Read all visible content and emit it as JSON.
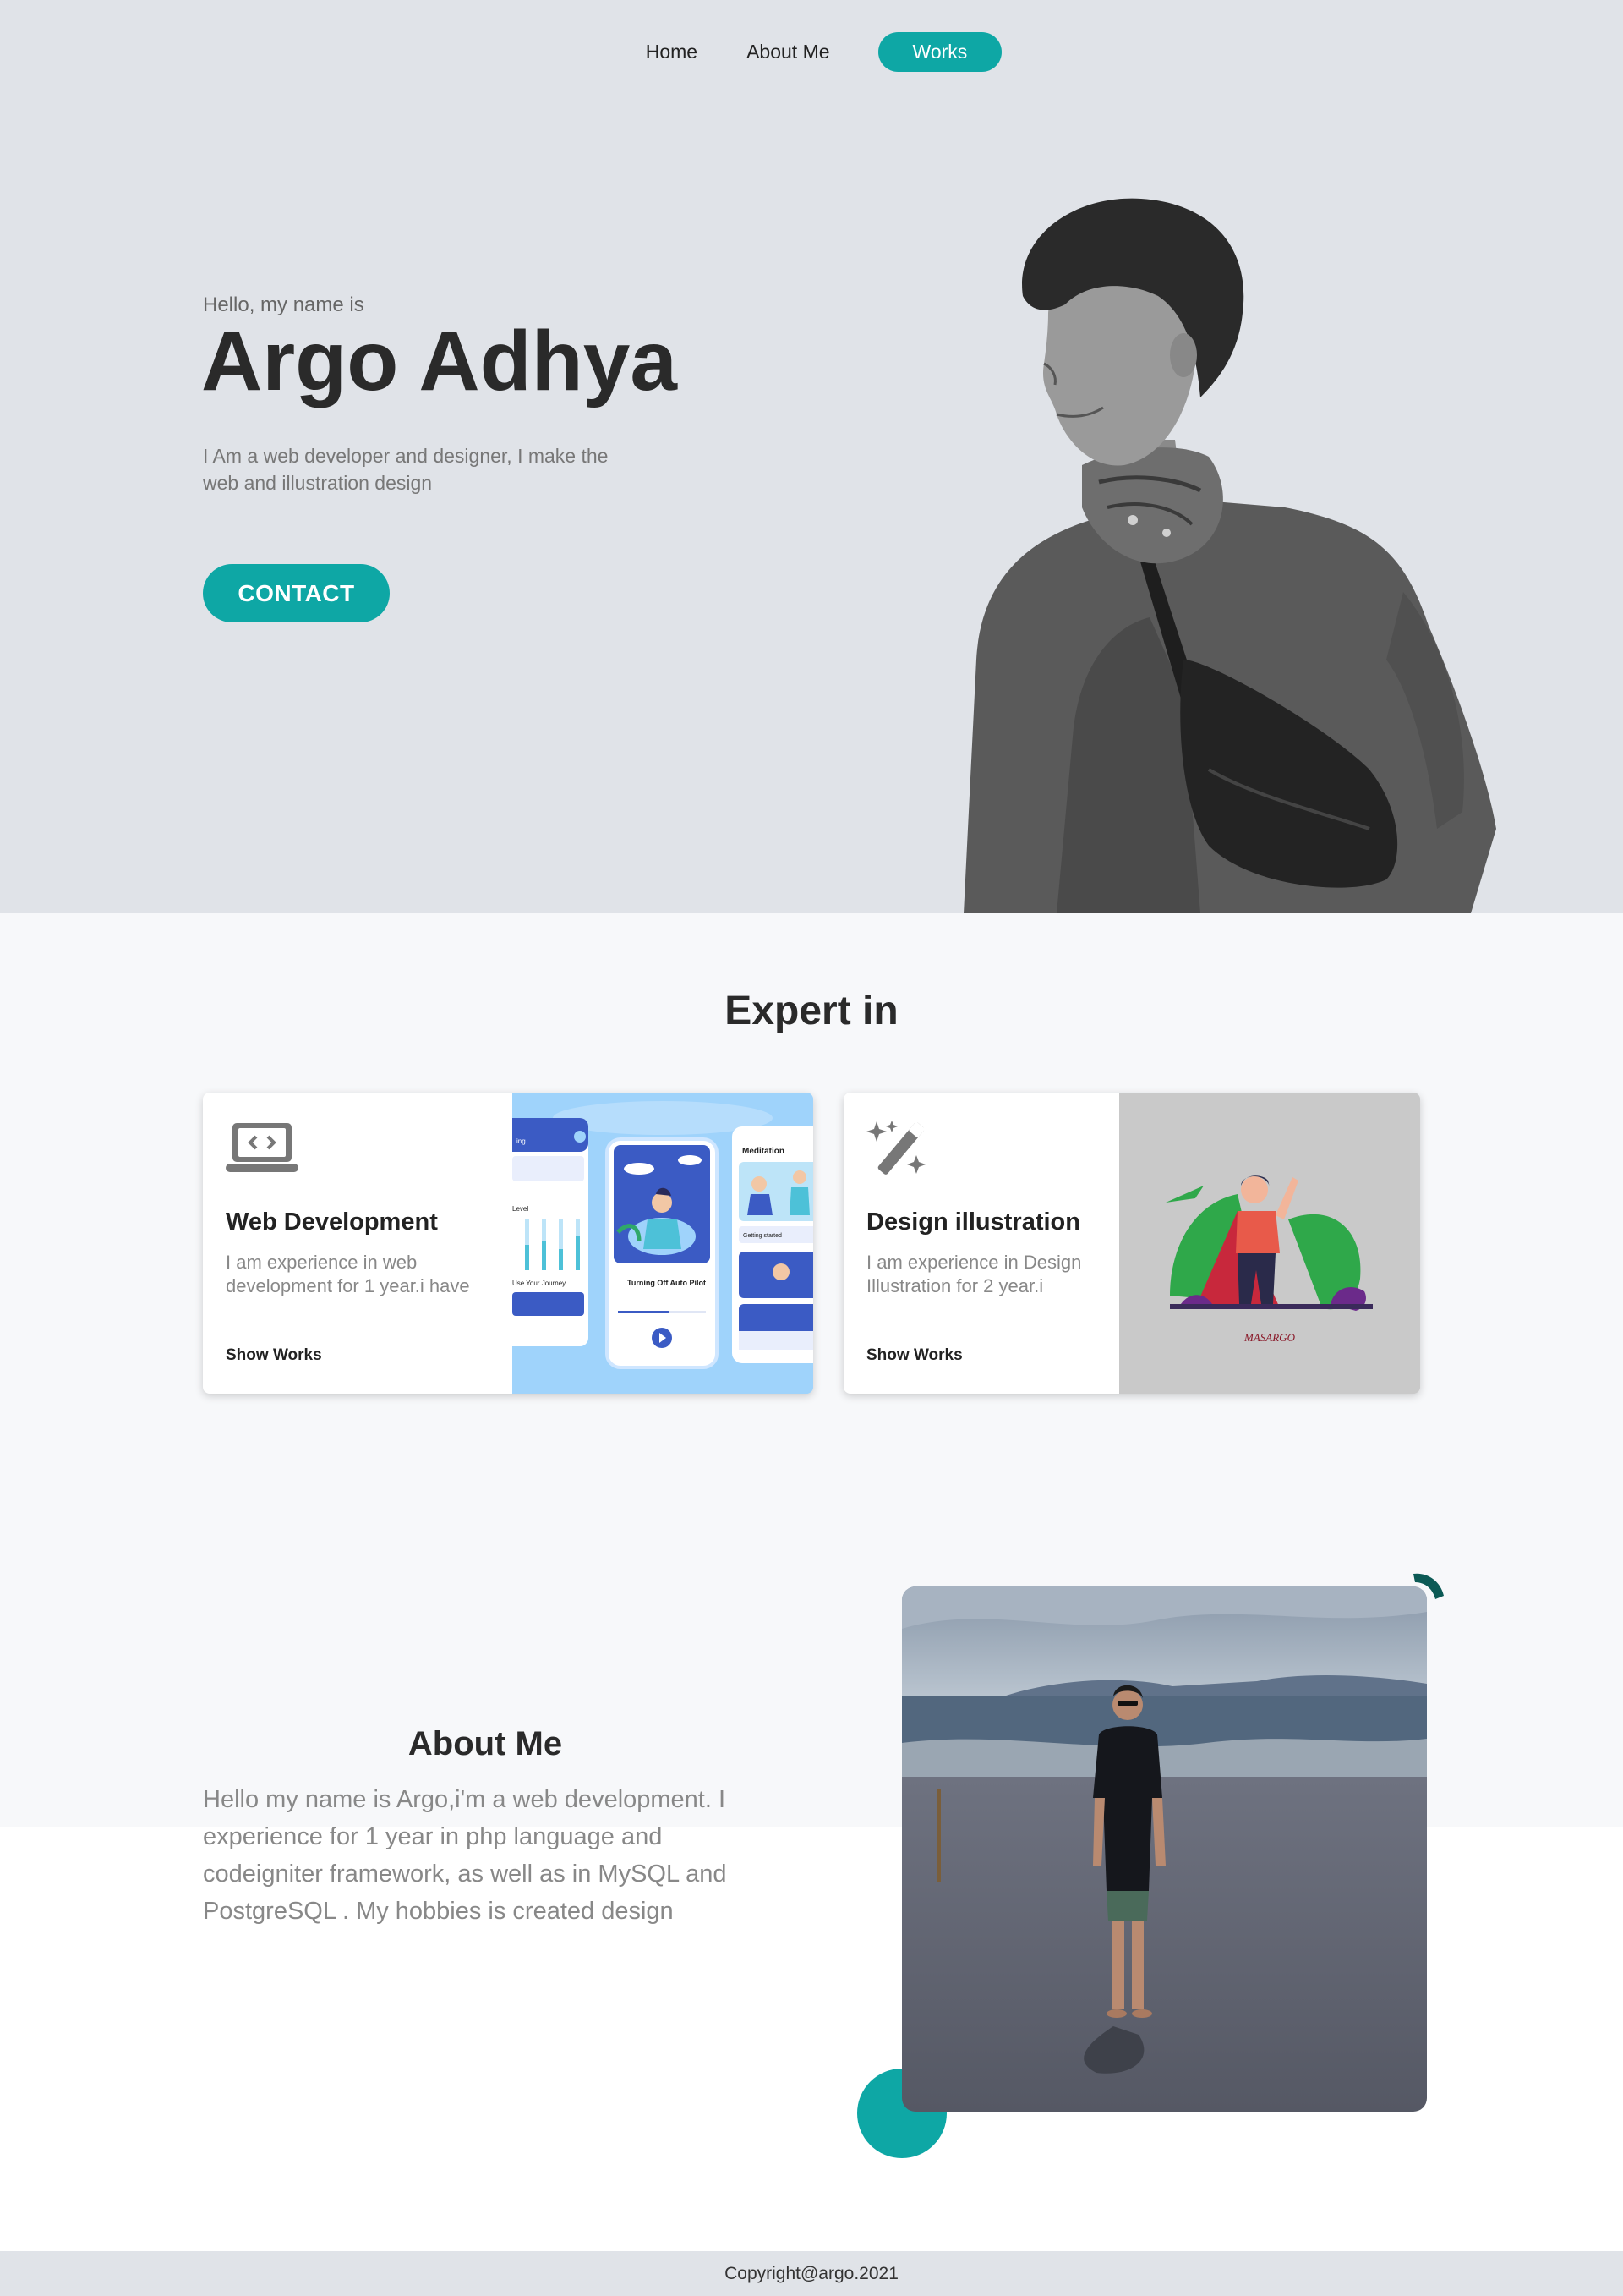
{
  "nav": {
    "items": [
      {
        "label": "Home"
      },
      {
        "label": "About Me"
      },
      {
        "label": "Works"
      }
    ],
    "active": "Works"
  },
  "hero": {
    "greeting": "Hello, my name is",
    "name": "Argo Adhya",
    "description": "I Am a web developer and designer, I make the web and illustration design",
    "contact_label": "CONTACT"
  },
  "expert": {
    "title": "Expert in",
    "cards": [
      {
        "icon": "laptop-code-icon",
        "title": "Web Development",
        "description": "I am experience in web development for 1 year.i have",
        "link": "Show Works",
        "preview_texts": [
          "Meditation",
          "Turning Off Auto Pilot",
          "Getting started",
          "Level",
          "Use Your Journey",
          "ing"
        ]
      },
      {
        "icon": "magic-wand-icon",
        "title": "Design illustration",
        "description": "I am experience in Design Illustration for 2 year.i",
        "link": "Show Works",
        "preview_texts": [
          "MASARGO"
        ]
      }
    ]
  },
  "about": {
    "title": "About Me",
    "text": "Hello my name is Argo,i'm  a web development. I experience for 1 year in php language and codeigniter framework, as well as in MySQL and PostgreSQL . My hobbies is created design"
  },
  "footer": {
    "copyright": "Copyright@argo.2021"
  },
  "colors": {
    "accent": "#0ea7a5",
    "hero_bg": "#e0e3e8",
    "section_bg": "#f7f8fa",
    "dark_accent": "#0c5a55"
  }
}
